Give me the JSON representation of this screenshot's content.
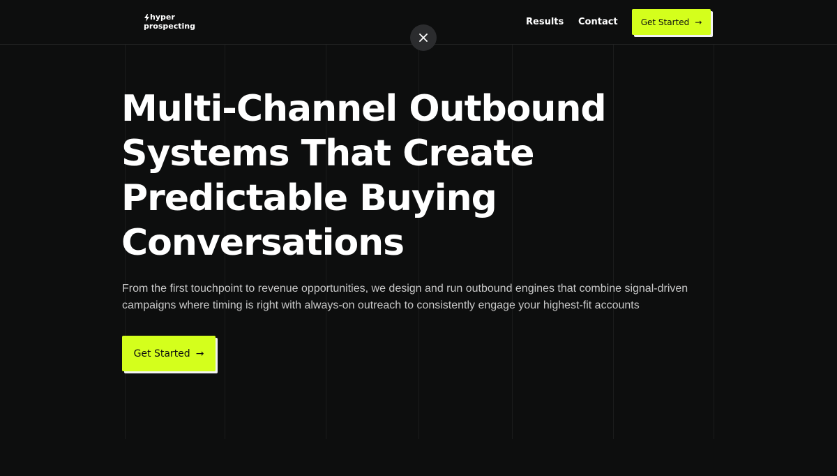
{
  "header": {
    "logo": {
      "line1": "hyper",
      "line2": "prospecting"
    },
    "nav": [
      {
        "label": "Results"
      },
      {
        "label": "Contact"
      }
    ],
    "cta_label": "Get Started",
    "cta_arrow": "→"
  },
  "overlay": {
    "close_icon": "close-icon"
  },
  "hero": {
    "title_lines": [
      "Multi-Channel Outbound",
      "Systems That Create",
      "Predictable Buying",
      "Conversations"
    ],
    "description": "From the first touchpoint to revenue opportunities, we design and run outbound engines that combine signal-driven campaigns where timing is right with always-on outreach to consistently engage your highest-fit accounts",
    "cta_label": "Get Started",
    "cta_arrow": "→"
  },
  "colors": {
    "background": "#0d0e0e",
    "accent": "#d4ff1c",
    "text": "#ffffff",
    "muted_text": "#c8c8c8"
  }
}
